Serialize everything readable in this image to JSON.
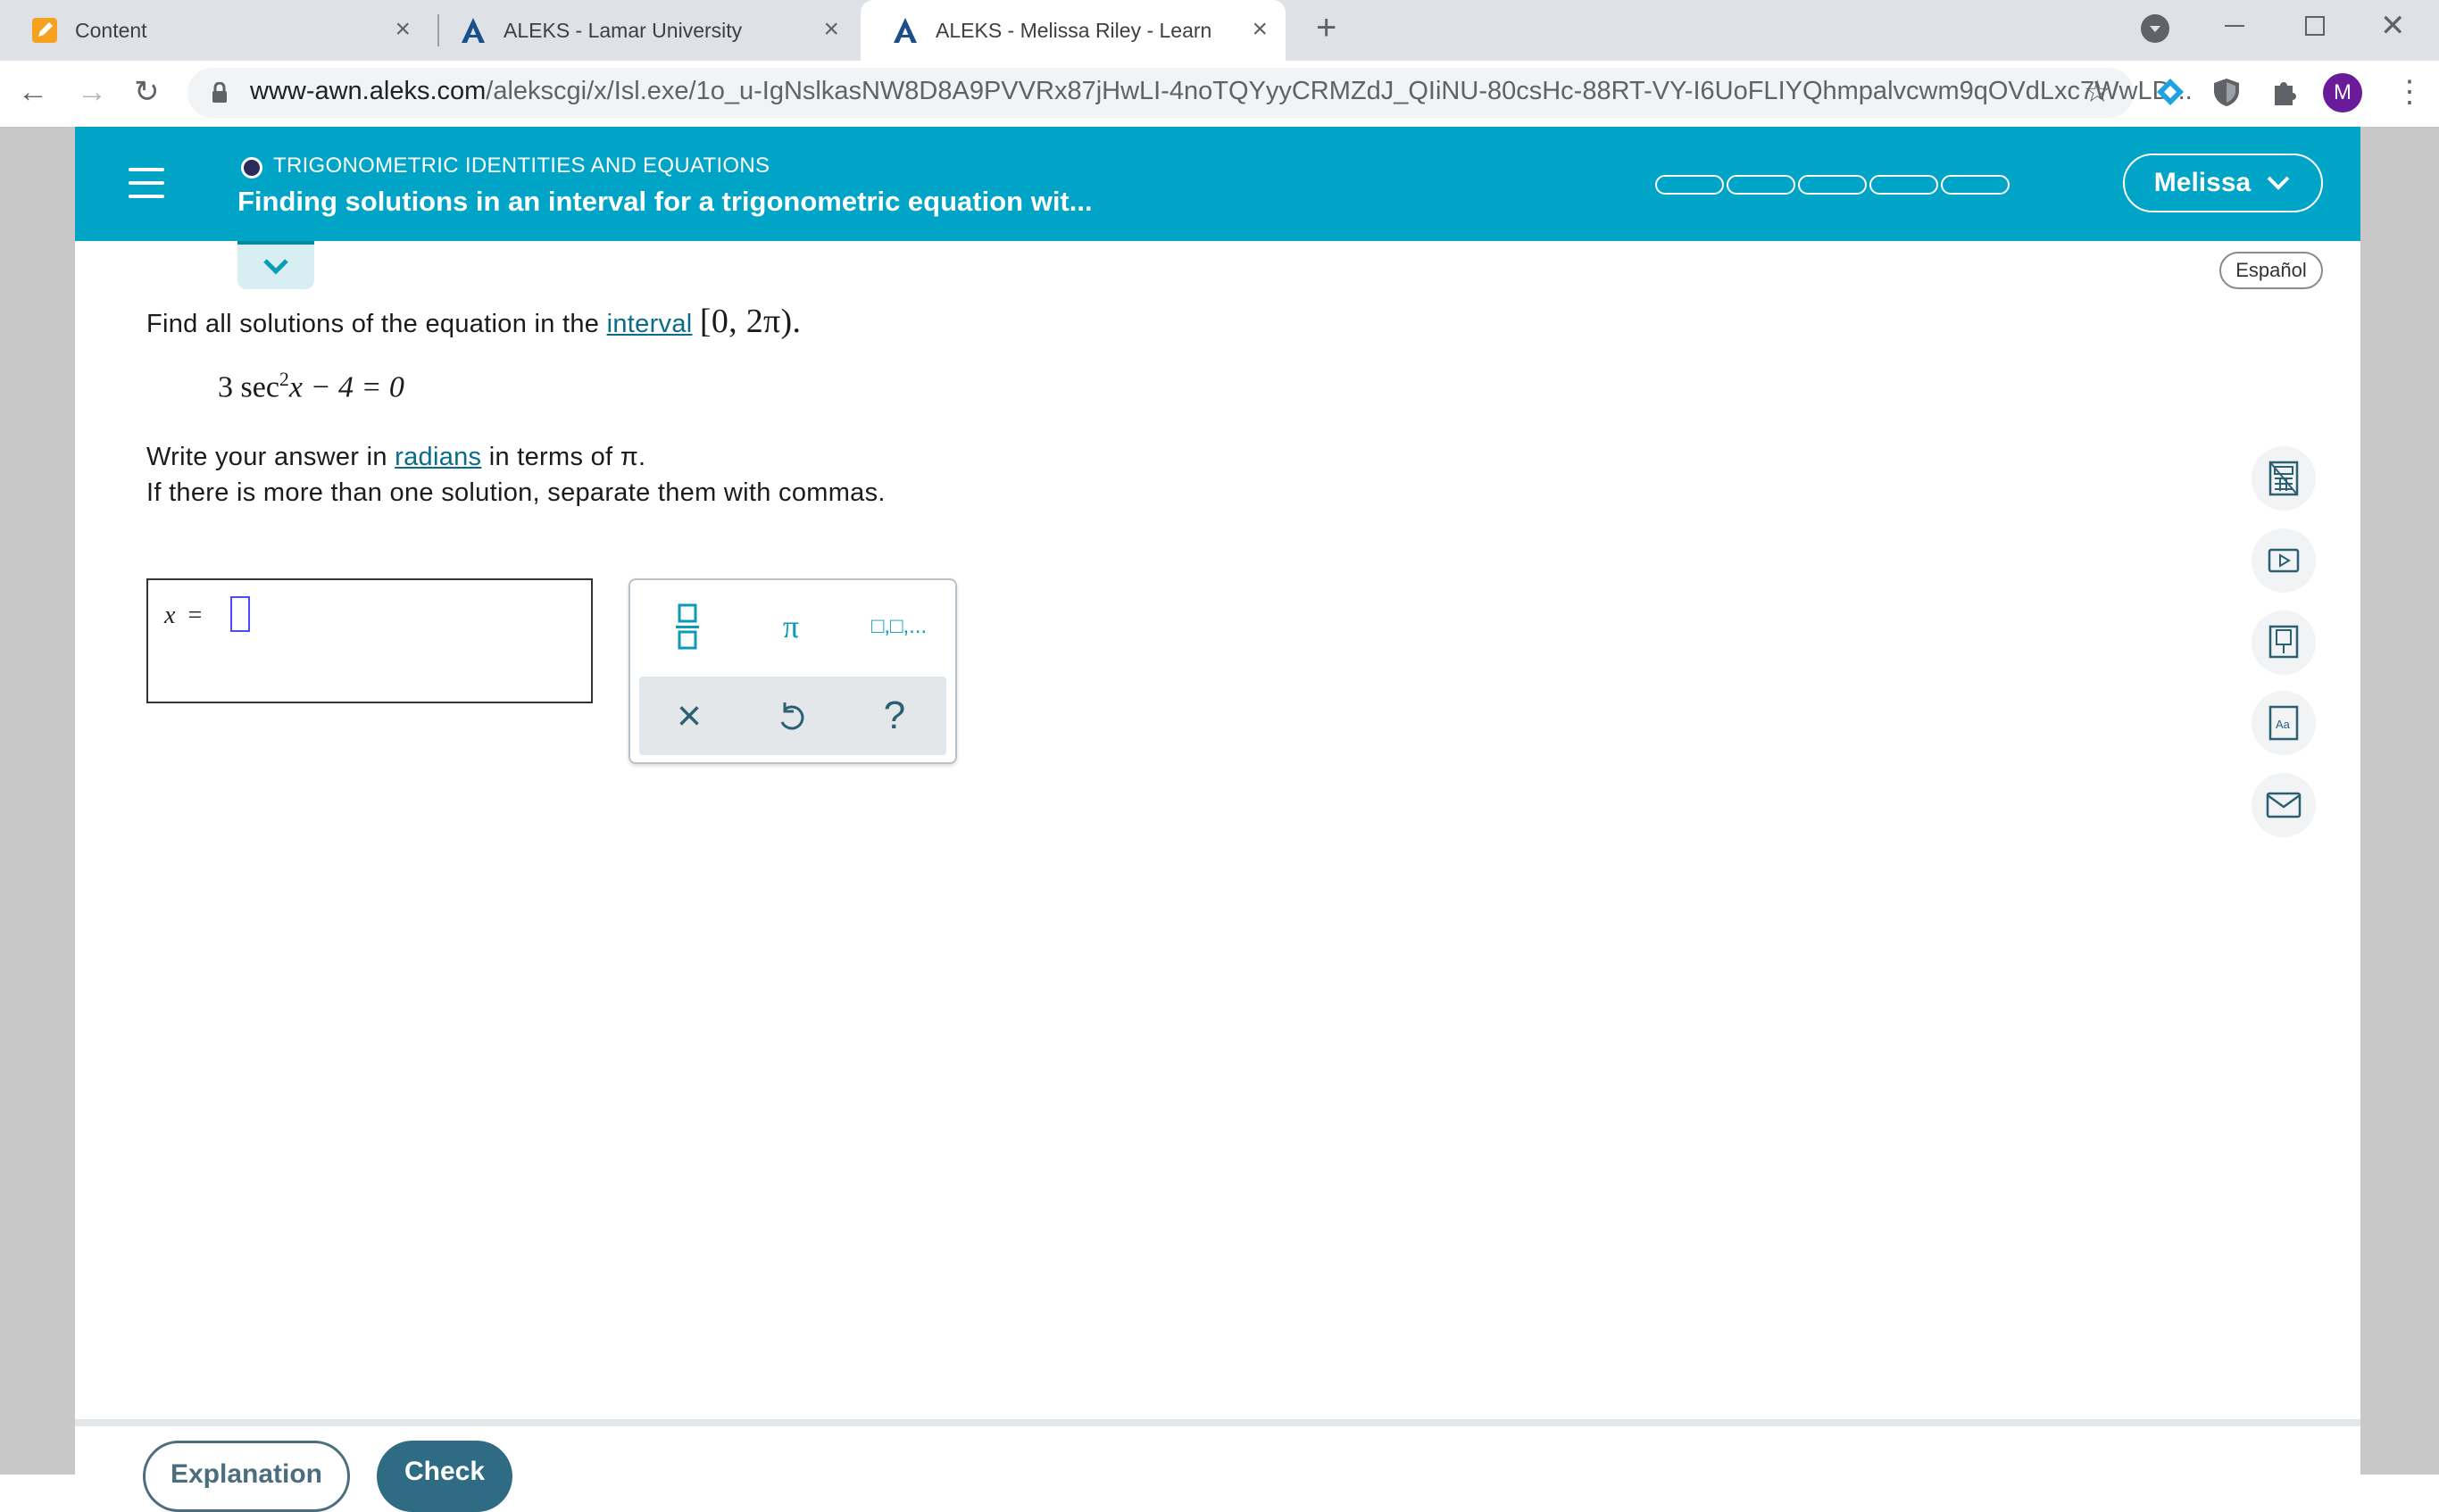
{
  "browser": {
    "tabs": [
      {
        "title": "Content",
        "active": false
      },
      {
        "title": "ALEKS - Lamar University",
        "active": false
      },
      {
        "title": "ALEKS - Melissa Riley - Learn",
        "active": true
      }
    ],
    "url_domain": "www-awn.aleks.com",
    "url_path": "/alekscgi/x/Isl.exe/1o_u-IgNslkasNW8D8A9PVVRx87jHwLI-4noTQYyyCRMZdJ_QIiNU-80csHc-88RT-VY-I6UoFLIYQhmpalvcwm9qOVdLxc7WwLD...",
    "profile_initial": "M",
    "colors": {
      "profile": "#6a1b9a",
      "tabstrip": "#dee1e6"
    }
  },
  "header": {
    "topic": "TRIGONOMETRIC IDENTITIES AND EQUATIONS",
    "lesson_title": "Finding solutions in an interval for a trigonometric equation wit...",
    "user_name": "Melissa",
    "progress_segments_filled": 0,
    "progress_segments_total": 5,
    "color": "#00a4c7"
  },
  "language_button": "Español",
  "problem": {
    "line1_before": "Find all solutions of the equation in the ",
    "line1_link": "interval",
    "interval": "[0, 2π).",
    "equation_coef": "3",
    "equation_fn": "sec",
    "equation_exp": "2",
    "equation_rest": "x − 4 = 0",
    "line3_before": "Write your answer in ",
    "line3_link": "radians",
    "line3_after": " in terms of π.",
    "line4": "If there is more than one solution, separate them with commas."
  },
  "answer": {
    "variable": "x",
    "equals": "=",
    "value": ""
  },
  "keypad": {
    "fraction_icon": "fraction-icon",
    "pi": "π",
    "list_label": "□,□,...",
    "clear": "×",
    "undo_icon": "undo-icon",
    "help": "?"
  },
  "side_tools": [
    "calculator-icon",
    "video-icon",
    "textbook-icon",
    "dictionary-icon",
    "mail-icon"
  ],
  "footer": {
    "explanation_label": "Explanation",
    "check_label": "Check"
  }
}
